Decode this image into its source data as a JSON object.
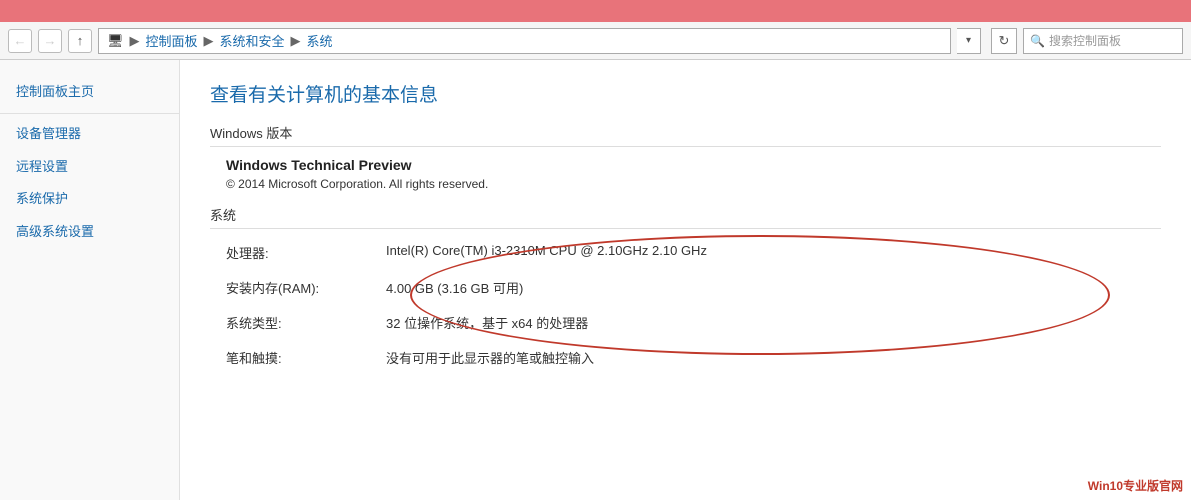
{
  "topbar": {},
  "addressbar": {
    "back_label": "←",
    "forward_label": "→",
    "up_label": "↑",
    "path": {
      "icon": "🖥",
      "part1": "控制面板",
      "sep1": "▶",
      "part2": "系统和安全",
      "sep2": "▶",
      "part3": "系统"
    },
    "dropdown_label": "▾",
    "refresh_label": "↻",
    "search_placeholder": "搜索控制面板"
  },
  "sidebar": {
    "items": [
      {
        "label": "控制面板主页"
      },
      {
        "label": "设备管理器"
      },
      {
        "label": "远程设置"
      },
      {
        "label": "系统保护"
      },
      {
        "label": "高级系统设置"
      }
    ]
  },
  "content": {
    "title": "查看有关计算机的基本信息",
    "windows_section_label": "Windows 版本",
    "windows_name": "Windows Technical Preview",
    "windows_copy": "© 2014 Microsoft Corporation. All rights reserved.",
    "system_section_label": "系统",
    "system_rows": [
      {
        "label": "处理器:",
        "value": "Intel(R) Core(TM) i3-2310M CPU @ 2.10GHz   2.10 GHz"
      },
      {
        "label": "安装内存(RAM):",
        "value": "4.00 GB (3.16 GB 可用)"
      },
      {
        "label": "系统类型:",
        "value": "32 位操作系统，基于 x64 的处理器"
      },
      {
        "label": "笔和触摸:",
        "value": "没有可用于此显示器的笔或触控输入"
      }
    ]
  },
  "watermark": {
    "label": "Win10专业版官网"
  }
}
